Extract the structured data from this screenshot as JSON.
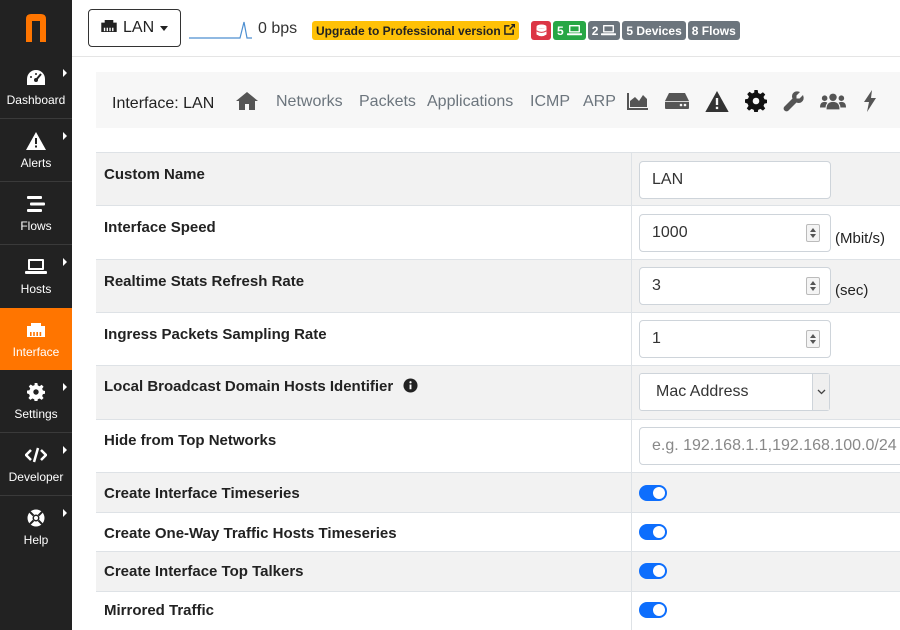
{
  "app": {
    "logo_letter": "n",
    "accent": "#ff7500",
    "sidebar_bg": "#222222"
  },
  "sidebar": {
    "items": [
      {
        "label": "Dashboard",
        "icon": "gauge-icon",
        "submenu": true
      },
      {
        "label": "Alerts",
        "icon": "warning-icon",
        "submenu": true
      },
      {
        "label": "Flows",
        "icon": "stream-icon",
        "submenu": false
      },
      {
        "label": "Hosts",
        "icon": "laptop-icon",
        "submenu": true
      },
      {
        "label": "Interface",
        "icon": "ethernet-icon",
        "submenu": false,
        "active": true
      },
      {
        "label": "Settings",
        "icon": "cog-icon",
        "submenu": true
      },
      {
        "label": "Developer",
        "icon": "code-icon",
        "submenu": true
      },
      {
        "label": "Help",
        "icon": "life-ring-icon",
        "submenu": true
      }
    ]
  },
  "topbar": {
    "interface_name": "LAN",
    "throughput": "0 bps",
    "upgrade_label": "Upgrade to Professional version",
    "badges": {
      "local_hosts": "5",
      "remote_hosts": "2",
      "devices": "5 Devices",
      "flows": "8 Flows"
    }
  },
  "interface_nav": {
    "title": "Interface: LAN",
    "tabs": [
      "Networks",
      "Packets",
      "Applications",
      "ICMP",
      "ARP"
    ],
    "icon_tabs": [
      "home-icon",
      "chart-area-icon",
      "hdd-icon",
      "warning-icon",
      "cog-icon",
      "wrench-icon",
      "users-icon",
      "bolt-icon"
    ]
  },
  "settings": {
    "rows": [
      {
        "label": "Custom Name",
        "type": "text",
        "value": "LAN"
      },
      {
        "label": "Interface Speed",
        "type": "number",
        "value": "1000",
        "unit": "(Mbit/s)"
      },
      {
        "label": "Realtime Stats Refresh Rate",
        "type": "number",
        "value": "3",
        "unit": "(sec)"
      },
      {
        "label": "Ingress Packets Sampling Rate",
        "type": "number",
        "value": "1"
      },
      {
        "label": "Local Broadcast Domain Hosts Identifier",
        "type": "select",
        "value": "Mac Address",
        "info": true
      },
      {
        "label": "Hide from Top Networks",
        "type": "text",
        "placeholder": "e.g. 192.168.1.1,192.168.100.0/24"
      },
      {
        "label": "Create Interface Timeseries",
        "type": "toggle",
        "value": "on"
      },
      {
        "label": "Create One-Way Traffic Hosts Timeseries",
        "type": "toggle",
        "value": "on"
      },
      {
        "label": "Create Interface Top Talkers",
        "type": "toggle",
        "value": "on"
      },
      {
        "label": "Mirrored Traffic",
        "type": "toggle",
        "value": "on"
      }
    ]
  }
}
